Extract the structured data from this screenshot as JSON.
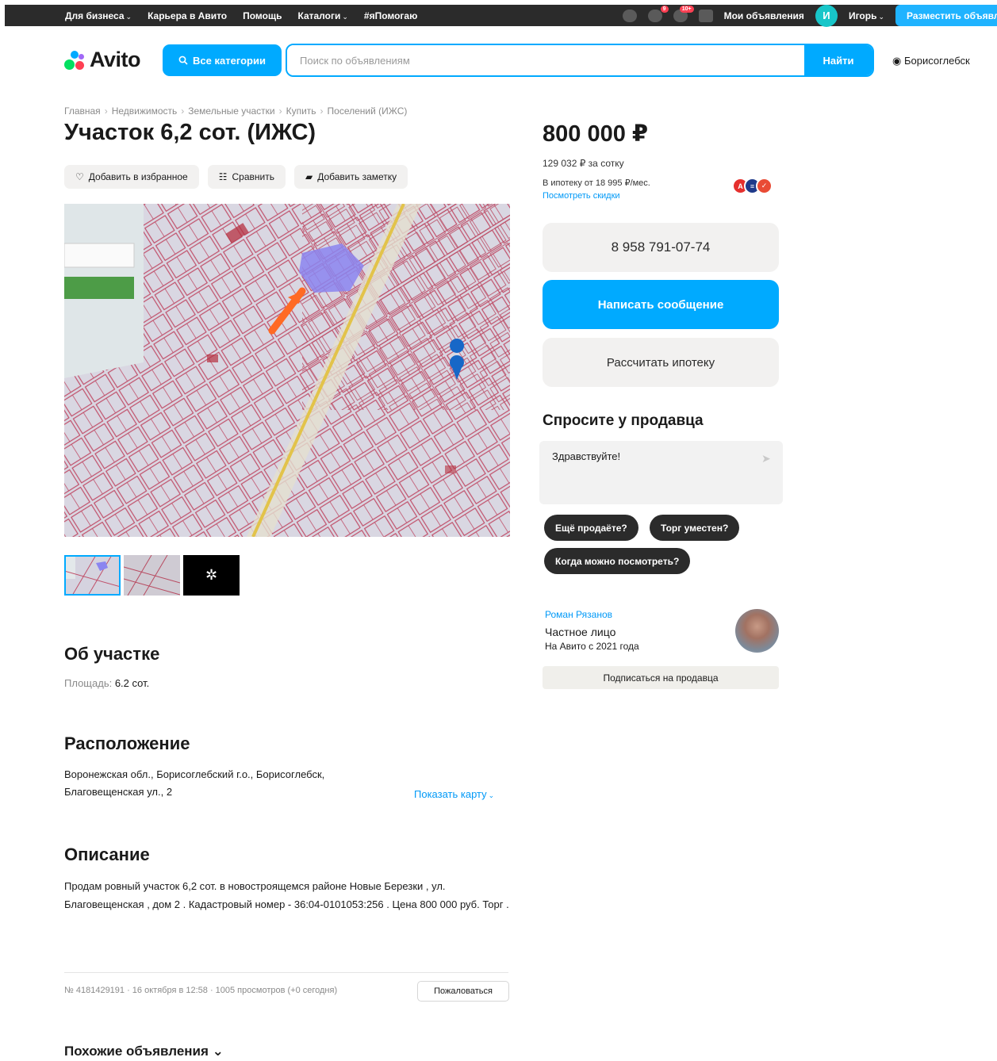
{
  "topbar": {
    "nav": [
      {
        "label": "Для бизнеса",
        "caret": true
      },
      {
        "label": "Карьера в Авито",
        "caret": false
      },
      {
        "label": "Помощь",
        "caret": false
      },
      {
        "label": "Каталоги",
        "caret": true
      },
      {
        "label": "#яПомогаю",
        "caret": false
      }
    ],
    "messages_badge": "9",
    "notifications_badge": "10+",
    "my_ads": "Мои объявления",
    "avatar_letter": "И",
    "user_name": "Игорь",
    "post_ad": "Разместить объявление"
  },
  "header": {
    "logo": "Avito",
    "categories_button": "Все категории",
    "search_placeholder": "Поиск по объявлениям",
    "search_button": "Найти",
    "city": "Борисоглебск"
  },
  "breadcrumbs": [
    "Главная",
    "Недвижимость",
    "Земельные участки",
    "Купить",
    "Поселений (ИЖС)"
  ],
  "listing": {
    "title": "Участок 6,2 сот. (ИЖС)",
    "actions": {
      "favorite": "Добавить в избранное",
      "compare": "Сравнить",
      "note": "Добавить заметку"
    },
    "about_title": "Об участке",
    "param_key": "Площадь:",
    "param_value": "6.2 сот.",
    "location_title": "Расположение",
    "address": "Воронежская обл., Борисоглебский г.о., Борисоглебск, Благовещенская ул., 2",
    "show_map": "Показать карту",
    "description_title": "Описание",
    "description": "Продам ровный участок 6,2 сот. в новостроящемся районе Новые Березки , ул. Благовещенская , дом 2 . Кадастровый номер - 36:04-0101053:256 . Цена 800 000 руб. Торг .",
    "meta": "№ 4181429191 · 16 октября в 12:58 · 1005 просмотров (+0 сегодня)",
    "report": "Пожаловаться",
    "similar": "Похожие объявления"
  },
  "sidebar": {
    "price": "800 000 ₽",
    "price_per_unit": "129 032 ₽ за сотку",
    "mortgage": "В ипотеку от 18 995 ₽/мес.",
    "discounts_link": "Посмотреть скидки",
    "phone": "8 958 791-07-74",
    "write_message": "Написать сообщение",
    "calc_mortgage": "Рассчитать ипотеку",
    "ask_title": "Спросите у продавца",
    "ask_default": "Здравствуйте!",
    "chips": [
      "Ещё продаёте?",
      "Торг уместен?",
      "Когда можно посмотреть?"
    ],
    "seller_name": "Роман Рязанов",
    "seller_type": "Частное лицо",
    "seller_since": "На Авито с 2021 года",
    "subscribe": "Подписаться на продавца"
  },
  "colors": {
    "accent": "#00aaff",
    "dark": "#2b2b2b",
    "light_bg": "#f2f1f0",
    "link": "#0099f7"
  }
}
